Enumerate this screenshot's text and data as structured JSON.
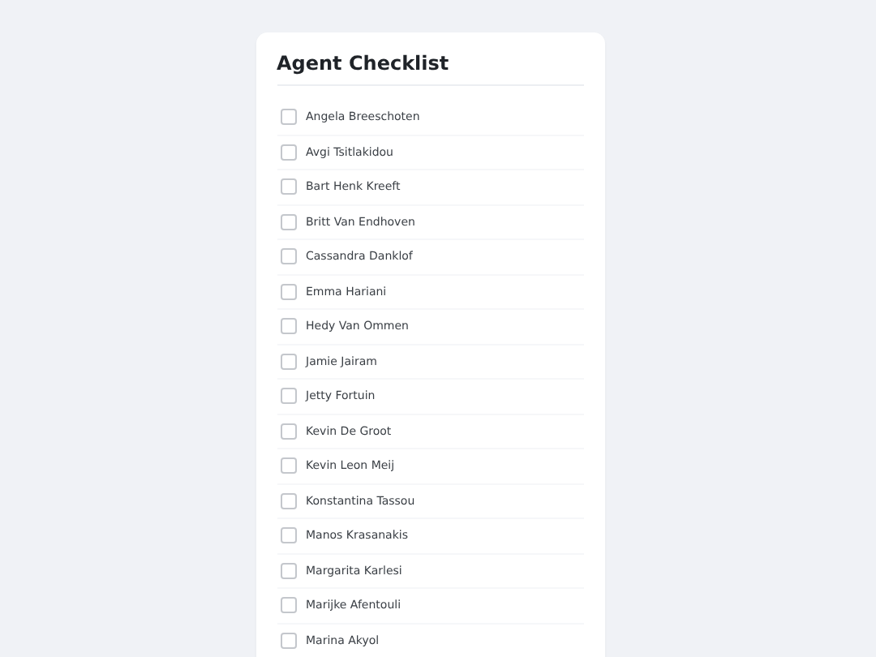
{
  "title": "Agent Checklist",
  "agents": [
    {
      "name": "Angela Breeschoten",
      "checked": false
    },
    {
      "name": "Avgi Tsitlakidou",
      "checked": false
    },
    {
      "name": "Bart Henk Kreeft",
      "checked": false
    },
    {
      "name": "Britt Van Endhoven",
      "checked": false
    },
    {
      "name": "Cassandra Danklof",
      "checked": false
    },
    {
      "name": "Emma Hariani",
      "checked": false
    },
    {
      "name": "Hedy Van Ommen",
      "checked": false
    },
    {
      "name": "Jamie Jairam",
      "checked": false
    },
    {
      "name": "Jetty Fortuin",
      "checked": false
    },
    {
      "name": "Kevin De Groot",
      "checked": false
    },
    {
      "name": "Kevin Leon Meij",
      "checked": false
    },
    {
      "name": "Konstantina Tassou",
      "checked": false
    },
    {
      "name": "Manos Krasanakis",
      "checked": false
    },
    {
      "name": "Margarita Karlesi",
      "checked": false
    },
    {
      "name": "Marijke Afentouli",
      "checked": false
    },
    {
      "name": "Marina Akyol",
      "checked": false
    }
  ]
}
